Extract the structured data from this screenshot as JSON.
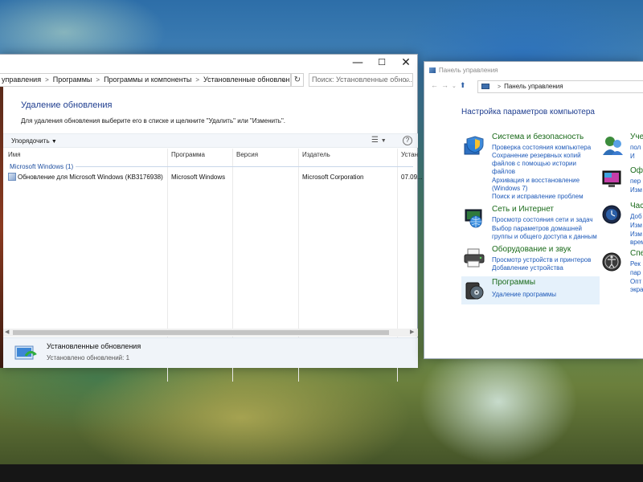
{
  "updates_window": {
    "window_controls": {
      "minimize": "—",
      "maximize": "☐",
      "close": "✕"
    },
    "breadcrumb": [
      "управления",
      "Программы",
      "Программы и компоненты",
      "Установленные обновления"
    ],
    "search_placeholder": "Поиск: Установленные обно...",
    "heading": "Удаление обновления",
    "instruction": "Для удаления обновления выберите его в списке и щелкните \"Удалить\" или \"Изменить\".",
    "toolbar": {
      "organize": "Упорядочить"
    },
    "columns": [
      "Имя",
      "Программа",
      "Версия",
      "Издатель",
      "Устан"
    ],
    "group": {
      "label": "Microsoft Windows (1)"
    },
    "rows": [
      {
        "name": "Обновление для Microsoft Windows (KB3176938)",
        "program": "Microsoft Windows",
        "version": "",
        "publisher": "Microsoft Corporation",
        "installed": "07.09..."
      }
    ],
    "details": {
      "title": "Установленные обновления",
      "count": "Установлено обновлений: 1"
    }
  },
  "control_panel": {
    "title": "Панель управления",
    "address": "Панель управления",
    "heading": "Настройка параметров компьютера",
    "categories": [
      {
        "title": "Система и безопасность",
        "links": [
          "Проверка состояния компьютера",
          "Сохранение резервных копий",
          "файлов с помощью истории",
          "файлов",
          "Архивация и восстановление",
          "(Windows 7)",
          "Поиск и исправление проблем"
        ],
        "icon": "system-security-icon"
      },
      {
        "title": "Сеть и Интернет",
        "links": [
          "Просмотр состояния сети и задач",
          "Выбор параметров домашней",
          "группы и общего доступа к данным"
        ],
        "icon": "network-icon"
      },
      {
        "title": "Оборудование и звук",
        "links": [
          "Просмотр устройств и принтеров",
          "Добавление устройства"
        ],
        "icon": "hardware-sound-icon"
      },
      {
        "title": "Программы",
        "links": [
          "Удаление программы"
        ],
        "icon": "programs-icon"
      }
    ],
    "right_categories": [
      {
        "title": "Уче",
        "links": [
          "пол",
          "И"
        ]
      },
      {
        "title": "Оф",
        "links": [
          "пер",
          "Изм"
        ]
      },
      {
        "title": "Час",
        "links": [
          "Доб",
          "Изм",
          "Изм",
          "врем"
        ]
      },
      {
        "title": "Спе",
        "links": [
          "Рек",
          "пар",
          "Опт",
          "экра"
        ]
      }
    ]
  }
}
